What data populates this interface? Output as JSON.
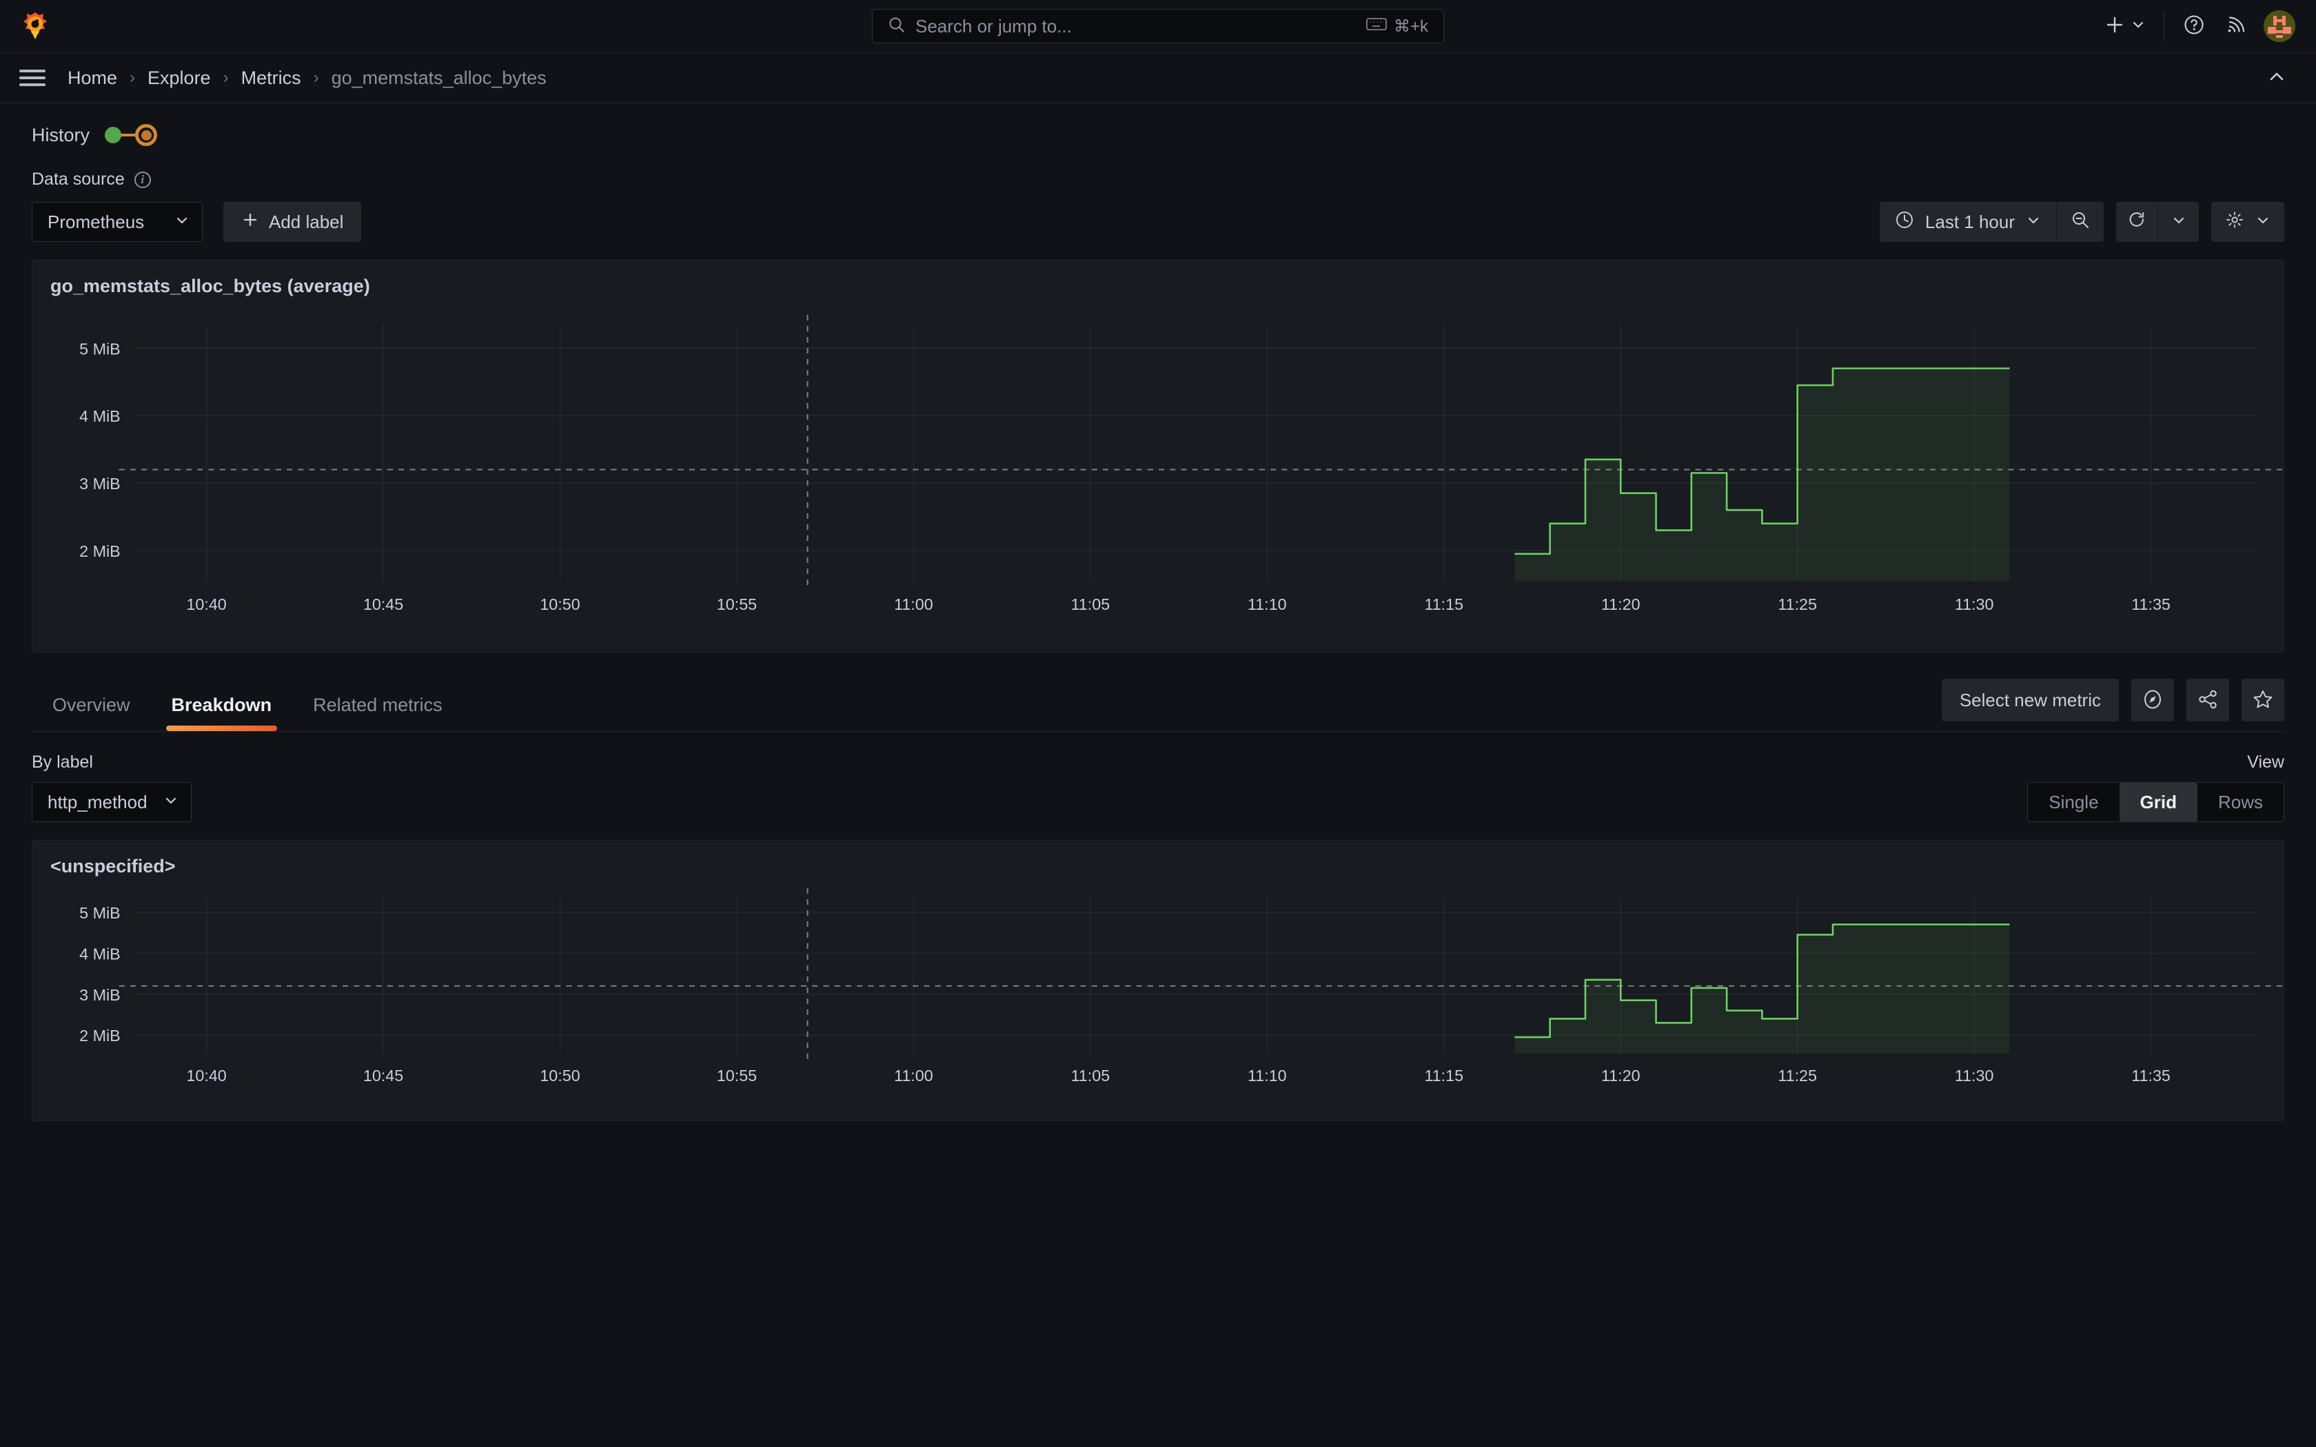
{
  "topnav": {
    "logo_icon": "grafana-logo-icon",
    "search": {
      "placeholder": "Search or jump to...",
      "shortcut": "⌘+k",
      "search_icon": "search-icon",
      "keyboard_icon": "keyboard-icon"
    },
    "add_label": "",
    "icons": {
      "plus": "plus-icon",
      "chevron": "chevron-down-icon",
      "help": "help-circle-icon",
      "news": "rss-news-icon",
      "avatar": "user-avatar"
    }
  },
  "breadcrumb": {
    "menu_icon": "hamburger-menu-icon",
    "items": [
      {
        "label": "Home",
        "current": false
      },
      {
        "label": "Explore",
        "current": false
      },
      {
        "label": "Metrics",
        "current": false
      },
      {
        "label": "go_memstats_alloc_bytes",
        "current": true
      }
    ],
    "separator": "›",
    "collapse_icon": "chevron-up-icon"
  },
  "history": {
    "label": "History",
    "nodes": 2
  },
  "controls": {
    "data_source_label": "Data source",
    "data_source_value": "Prometheus",
    "info_icon": "info-icon",
    "add_label_button": "Add label",
    "plus_icon": "plus-icon",
    "chevron_icon": "chevron-down-icon",
    "time_range": "Last 1 hour",
    "clock_icon": "clock-icon",
    "zoom_out_icon": "zoom-out-icon",
    "refresh_icon": "refresh-icon",
    "settings_icon": "gear-icon"
  },
  "main_panel": {
    "title": "go_memstats_alloc_bytes (average)"
  },
  "tabs": {
    "items": [
      {
        "label": "Overview",
        "active": false
      },
      {
        "label": "Breakdown",
        "active": true
      },
      {
        "label": "Related metrics",
        "active": false
      }
    ],
    "select_new_metric": "Select new metric",
    "explore_icon": "compass-icon",
    "share_icon": "share-icon",
    "bookmark_icon": "star-icon"
  },
  "breakdown": {
    "by_label_title": "By label",
    "by_label_value": "http_method",
    "view_title": "View",
    "view_options": [
      {
        "label": "Single",
        "selected": false
      },
      {
        "label": "Grid",
        "selected": true
      },
      {
        "label": "Rows",
        "selected": false
      }
    ],
    "panel_title": "<unspecified>"
  },
  "colors": {
    "series_line": "#6ccf62",
    "series_fill": "rgba(86,166,75,0.12)",
    "accent_orange": "#f05a28",
    "history_green": "#56a64b",
    "history_orange": "#d2892d",
    "panel_bg": "#181b1f",
    "app_bg": "#111217"
  },
  "chart_data": {
    "type": "area",
    "title": "go_memstats_alloc_bytes (average)",
    "xlabel": "",
    "ylabel": "",
    "unit": "MiB",
    "grid": true,
    "legend": "none",
    "xlim": [
      "10:38",
      "11:38"
    ],
    "ylim": [
      1.55,
      5.35
    ],
    "yticks": [
      2,
      3,
      4,
      5
    ],
    "ytick_labels": [
      "2 MiB",
      "3 MiB",
      "4 MiB",
      "5 MiB"
    ],
    "xticks": [
      "10:40",
      "10:45",
      "10:50",
      "10:55",
      "11:00",
      "11:05",
      "11:10",
      "11:15",
      "11:20",
      "11:25",
      "11:30",
      "11:35"
    ],
    "threshold_line": {
      "value": 3.2,
      "style": "dashed",
      "color": "#808087"
    },
    "annotation_line": {
      "x": "10:57",
      "style": "dashed",
      "color": "#808087"
    },
    "series": [
      {
        "name": "go_memstats_alloc_bytes",
        "style": "step",
        "x": [
          "11:17",
          "11:18",
          "11:18",
          "11:19",
          "11:19",
          "11:20",
          "11:20",
          "11:21",
          "11:21",
          "11:22",
          "11:22",
          "11:23",
          "11:23",
          "11:24",
          "11:24",
          "11:25",
          "11:25",
          "11:26",
          "11:26",
          "11:27",
          "11:27",
          "11:31"
        ],
        "values": [
          1.95,
          1.95,
          2.4,
          2.4,
          3.35,
          3.35,
          2.85,
          2.85,
          2.3,
          2.3,
          3.15,
          3.15,
          2.6,
          2.6,
          2.4,
          2.4,
          4.45,
          4.45,
          4.7,
          4.7,
          4.7,
          4.7
        ]
      }
    ],
    "panels": [
      {
        "title": "go_memstats_alloc_bytes (average)"
      },
      {
        "title": "<unspecified>"
      }
    ]
  }
}
